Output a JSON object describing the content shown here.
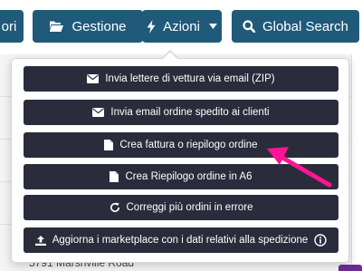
{
  "toolbar": {
    "cut_button_label": "ori",
    "gestione_label": "Gestione",
    "azioni_label": "Azioni",
    "global_search_label": "Global Search"
  },
  "dropdown": {
    "items": [
      {
        "label": "Invia lettere di vettura via email (ZIP)",
        "icon": "envelope-icon"
      },
      {
        "label": "Invia email ordine spedito ai clienti",
        "icon": "envelope-icon"
      },
      {
        "label": "Crea fattura o riepilogo ordine",
        "icon": "file-icon"
      },
      {
        "label": "Crea Riepilogo ordine in A6",
        "icon": "file-icon"
      },
      {
        "label": "Correggi più ordini in errore",
        "icon": "refresh-icon"
      },
      {
        "label": "Aggiorna i marketplace con i dati relativi alla spedizione",
        "icon": "upload-icon",
        "info_icon": "info-circle-icon"
      }
    ]
  },
  "background": {
    "address_text": "5791 Marshville Road"
  },
  "colors": {
    "toolbar_button": "#1f5a7a",
    "menu_item": "#2a2c3c",
    "annotation_arrow": "#ff1493"
  }
}
